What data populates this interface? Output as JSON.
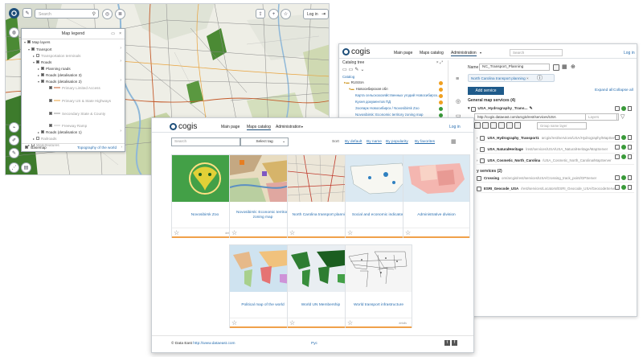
{
  "map_window": {
    "search_placeholder": "Search",
    "login_label": "Log in",
    "legend": {
      "title": "Map legend",
      "rows": [
        {
          "label": "Map layers"
        },
        {
          "label": "Transport"
        },
        {
          "label": "Transportation terminals"
        },
        {
          "label": "Roads"
        },
        {
          "label": "Planning roads"
        },
        {
          "label": "Roads (detalisation 3)"
        },
        {
          "label": "Roads (detalisation 2)"
        },
        {
          "label": "Primary Limited Access"
        },
        {
          "label": "Primary US & State Highways"
        },
        {
          "label": "Secondary State & County"
        },
        {
          "label": "Freeway Ramp"
        },
        {
          "label": "Roads (detalisation 1)"
        },
        {
          "label": "Railroads"
        },
        {
          "label": "Waterfeatures"
        }
      ],
      "basemap_label": "Basemap",
      "basemap_link": "Topography of the world"
    }
  },
  "layer_window": {
    "brand": "cogis",
    "nav": [
      "Main page",
      "Maps catalog",
      "Administration"
    ],
    "search_placeholder": "Search",
    "login_label": "Log in",
    "tree_title": "Catalog tree",
    "tree_rows": [
      {
        "label": "Catalog"
      },
      {
        "label": "RUSSIA"
      },
      {
        "label": "Новосибирская обл"
      },
      {
        "label": "Карта сельскохозяйственных угодий Новосибирск..."
      },
      {
        "label": "Кухня документов ПД"
      },
      {
        "label": "Зоопарк Новосибирск / Novosibirsk Zoo"
      },
      {
        "label": "Novosibirsk: Economic territory zoning map"
      },
      {
        "label": "Карта - Бюджет Новосибирск (Zoo)"
      },
      {
        "label": "USA"
      }
    ],
    "name_label": "Name",
    "name_value": "NC_Transport_Planning",
    "chip_label": "North Carolina transport planning",
    "add_service_label": "Add service",
    "expand_all": "Expand all",
    "collapse_all": "Collapse all",
    "general_header": "General map services (4)",
    "editing_service": "USA_Hydrography_Trans...",
    "url_value": "http://cogis.dataeast.com/arcgis/rest/services/USA",
    "layers_placeholder": "Layers",
    "group_name_placeholder": "Group name layer",
    "services": [
      {
        "name": "USA_Hydrography_Transport1",
        "url": "arcgis/rest/services/USA/Hydrography/MapServer"
      },
      {
        "name": "USA_NaturalHeritage",
        "url": "/rest/services/USA/USA_NaturalHeritage/MapServer"
      },
      {
        "name": "USA_Cosmetic_North_Carolina",
        "url": "/USA_Cosmetic_North_Carolina/MapServer"
      }
    ],
    "other_header": "y services (2)",
    "other_services": [
      {
        "name": "Crossing",
        "url": "om/arcgis/rest/services/USA/Crossing_track_point/GPServer"
      },
      {
        "name": "ESRI_Geocode_USA",
        "url": "/rest/services/Locators/ESRI_Geocode_USA/GeocodeServer"
      }
    ]
  },
  "catalog_window": {
    "brand": "cogis",
    "nav": [
      "Main page",
      "Maps catalog",
      "Administration"
    ],
    "login_label": "Log in",
    "search_placeholder": "Search",
    "tag_select": "Select tag",
    "sort_label": "Sort",
    "sort_options": [
      "By default",
      "By name",
      "By popularity",
      "By favorites"
    ],
    "cards": [
      {
        "title": "Novosibirsk Zoo",
        "meta": "details",
        "thumb_color": "#4caf50"
      },
      {
        "title": "Novosibirsk: Economic territory zoning map",
        "meta": "",
        "thumb_color": "#d9c9a0"
      },
      {
        "title": "North Carolina transport planning",
        "meta": "",
        "thumb_color": "#e8e0d0"
      },
      {
        "title": "Social and economic indicators",
        "meta": "",
        "thumb_color": "#c8dde8"
      },
      {
        "title": "Administrative division",
        "meta": "",
        "thumb_color": "#f2b8b8"
      },
      {
        "title": "Political map of the world",
        "meta": "",
        "thumb_color": "#c9e3a3"
      },
      {
        "title": "World UN Membership",
        "meta": "",
        "thumb_color": "#2f7a3c"
      },
      {
        "title": "World transport infrastructure",
        "meta": "details",
        "thumb_color": "#f2f2f2"
      }
    ],
    "footer_copyright": "© Data East",
    "footer_link": "http://www.dataeast.com",
    "footer_lang": "Рус"
  }
}
